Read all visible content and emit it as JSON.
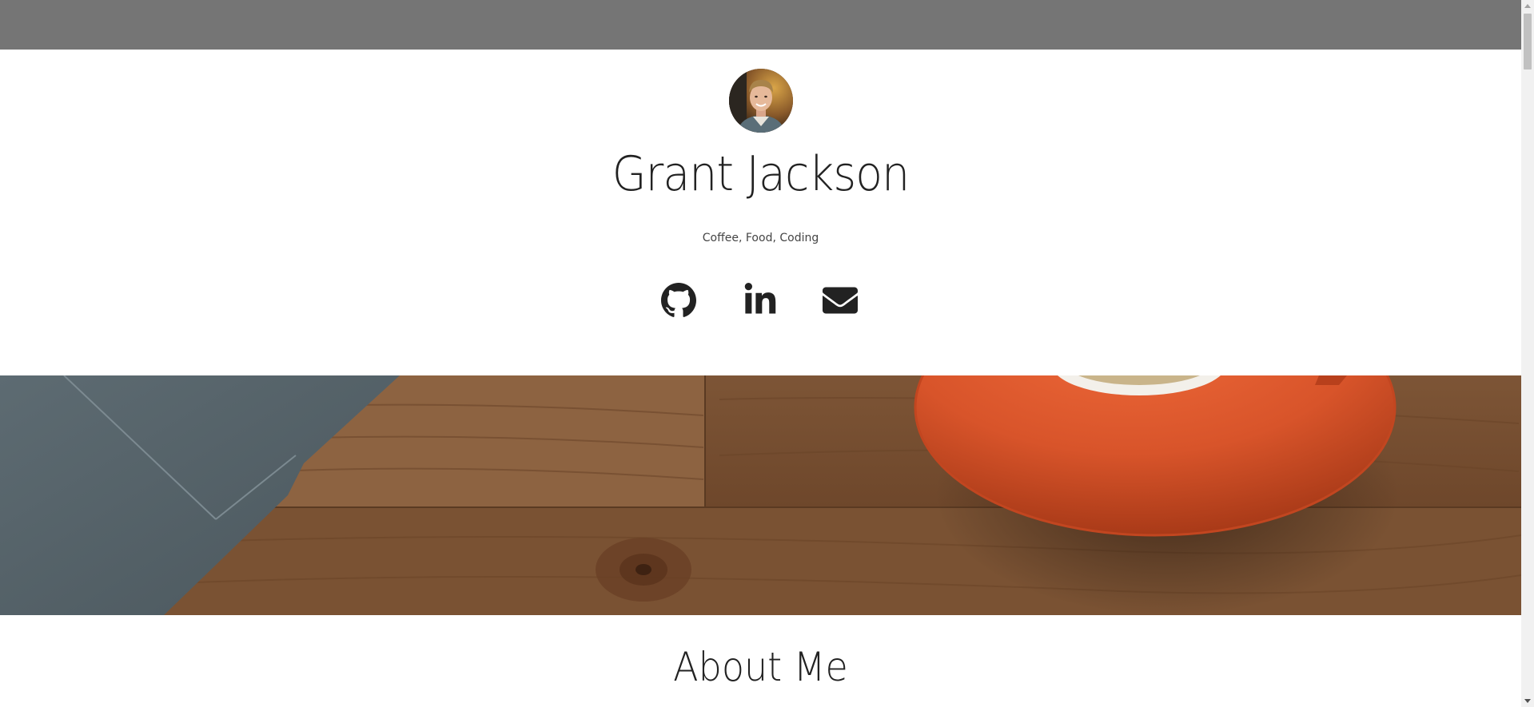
{
  "profile": {
    "name": "Grant Jackson",
    "tagline": "Coffee, Food, Coding",
    "avatar_icon": "profile-photo"
  },
  "social": [
    {
      "name": "github",
      "icon": "github-icon"
    },
    {
      "name": "linkedin",
      "icon": "linkedin-icon"
    },
    {
      "name": "email",
      "icon": "envelope-icon"
    }
  ],
  "hero": {
    "image": "coffee-cup-on-wooden-desk"
  },
  "sections": {
    "about_title": "About Me"
  },
  "colors": {
    "topbar": "#757575",
    "text": "#222222",
    "icons": "#222222"
  }
}
